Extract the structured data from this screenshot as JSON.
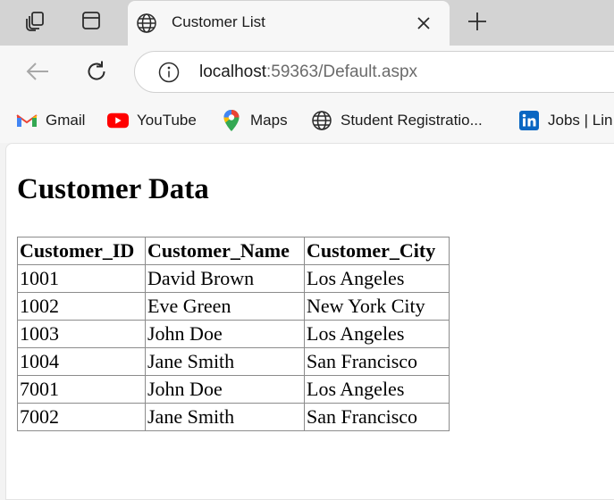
{
  "browser": {
    "tab": {
      "title": "Customer List"
    },
    "address": {
      "host": "localhost",
      "path": ":59363/Default.aspx"
    },
    "bookmarks": [
      {
        "label": "Gmail",
        "icon": "gmail-icon"
      },
      {
        "label": "YouTube",
        "icon": "youtube-icon"
      },
      {
        "label": "Maps",
        "icon": "maps-icon"
      },
      {
        "label": "Student Registratio...",
        "icon": "globe-icon"
      },
      {
        "label": "Jobs | Lin",
        "icon": "linkedin-icon"
      }
    ]
  },
  "page": {
    "heading": "Customer Data",
    "table": {
      "columns": [
        "Customer_ID",
        "Customer_Name",
        "Customer_City"
      ],
      "rows": [
        [
          "1001",
          "David Brown",
          "Los Angeles"
        ],
        [
          "1002",
          "Eve Green",
          "New York City"
        ],
        [
          "1003",
          "John Doe",
          "Los Angeles"
        ],
        [
          "1004",
          "Jane Smith",
          "San Francisco"
        ],
        [
          "7001",
          "John Doe",
          "Los Angeles"
        ],
        [
          "7002",
          "Jane Smith",
          "San Francisco"
        ]
      ]
    }
  },
  "colors": {
    "gmail": "#ea4335",
    "youtube": "#ff0000",
    "linkedin": "#0a66c2",
    "tabstrip": "#d3d3d3"
  }
}
